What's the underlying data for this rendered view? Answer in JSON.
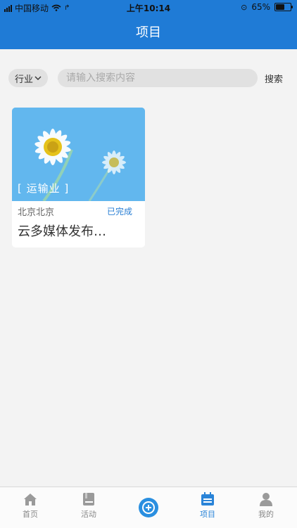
{
  "status_bar": {
    "carrier": "中国移动",
    "time": "上午10:14",
    "battery": "65%",
    "battery_level": 0.65
  },
  "header": {
    "title": "项目"
  },
  "search": {
    "filter_label": "行业",
    "placeholder": "请输入搜索内容",
    "button_label": "搜索"
  },
  "projects": [
    {
      "industry_tag": "[ 运输业 ]",
      "location": "北京北京",
      "status": "已完成",
      "title": "云多媒体发布…"
    }
  ],
  "tabbar": {
    "items": [
      {
        "label": "首页",
        "icon": "home-icon"
      },
      {
        "label": "活动",
        "icon": "book-icon"
      },
      {
        "label": "",
        "icon": "plus-circle-icon"
      },
      {
        "label": "项目",
        "icon": "calendar-icon"
      },
      {
        "label": "我的",
        "icon": "user-icon"
      }
    ],
    "active_color": "#2a84d8"
  },
  "colors": {
    "header_bg": "#1f7bd6",
    "accent": "#2a84d8"
  }
}
